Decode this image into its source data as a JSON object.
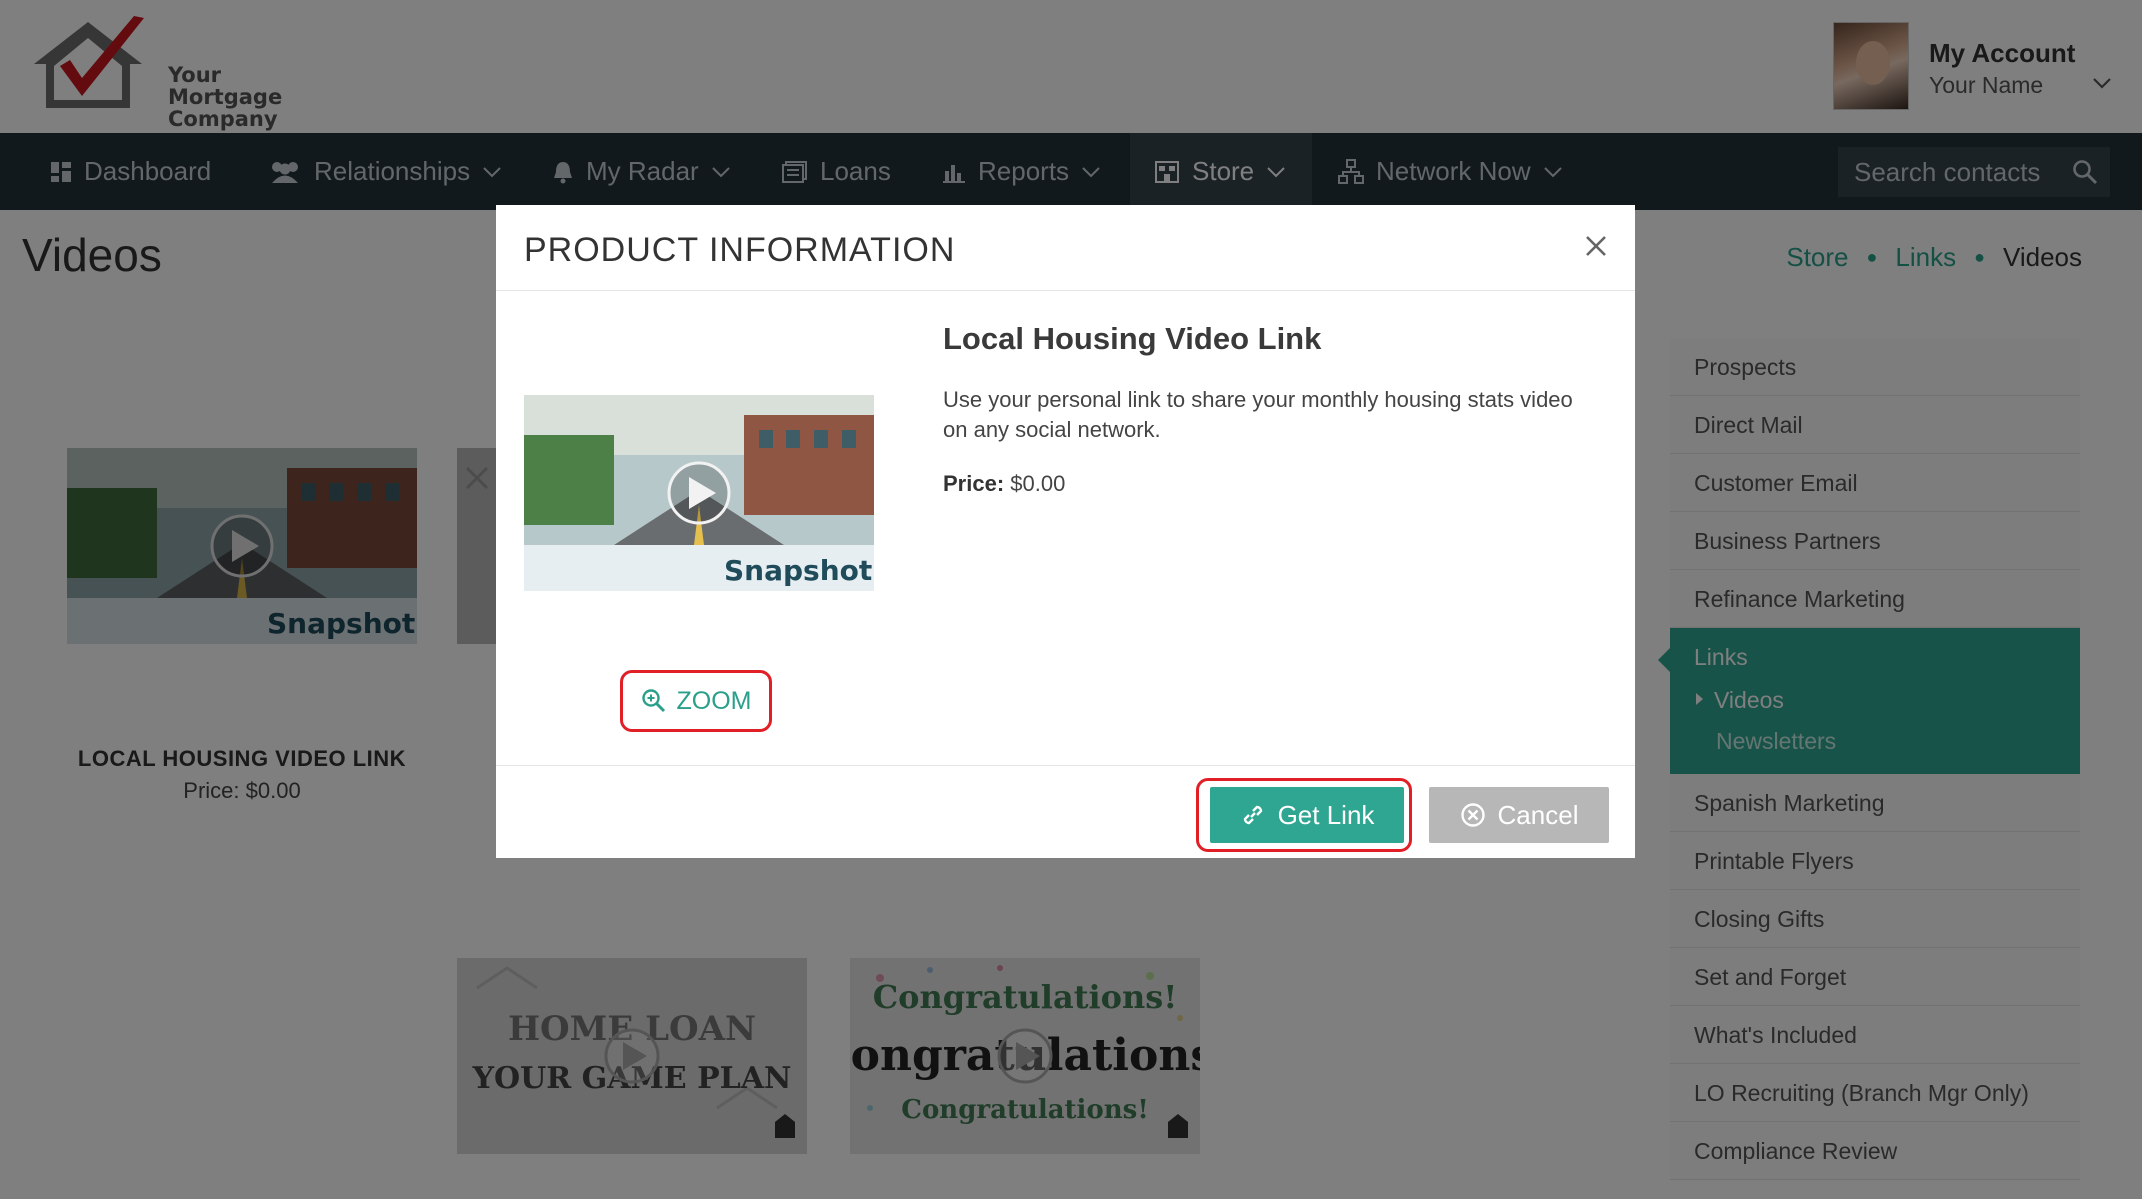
{
  "header": {
    "logo": {
      "line1": "Your",
      "line2": "Mortgage",
      "line3": "Company"
    },
    "account": {
      "title": "My Account",
      "name": "Your Name"
    }
  },
  "nav": {
    "items": [
      {
        "label": "Dashboard",
        "icon": "dashboard-icon"
      },
      {
        "label": "Relationships",
        "icon": "users-icon"
      },
      {
        "label": "My Radar",
        "icon": "bell-icon"
      },
      {
        "label": "Loans",
        "icon": "document-icon"
      },
      {
        "label": "Reports",
        "icon": "bar-chart-icon"
      },
      {
        "label": "Store",
        "icon": "store-icon"
      },
      {
        "label": "Network Now",
        "icon": "network-icon"
      }
    ],
    "search_placeholder": "Search contacts"
  },
  "page": {
    "title": "Videos",
    "breadcrumb": [
      "Store",
      "Links",
      "Videos"
    ]
  },
  "products": [
    {
      "name": "LOCAL HOUSING VIDEO LINK",
      "price": "Price: $0.00",
      "thumb_text": "Snapshot"
    },
    {
      "thumb_line1": "HOME LOAN",
      "thumb_line2": "YOUR GAME PLAN"
    },
    {
      "thumb_line1": "Congratulations!",
      "thumb_line2": "Congratulations!",
      "thumb_line3": "Congratulations!"
    }
  ],
  "sidebar": {
    "items_before": [
      "Prospects",
      "Direct Mail",
      "Customer Email",
      "Business Partners",
      "Refinance Marketing"
    ],
    "active": {
      "label": "Links",
      "sub_active": "Videos",
      "sub_other": "Newsletters"
    },
    "items_after": [
      "Spanish Marketing",
      "Printable Flyers",
      "Closing Gifts",
      "Set and Forget",
      "What's Included",
      "LO Recruiting (Branch Mgr Only)",
      "Compliance Review"
    ]
  },
  "modal": {
    "title": "PRODUCT INFORMATION",
    "product_title": "Local Housing Video Link",
    "description": "Use your personal link to share your monthly housing stats video on any social network.",
    "price_label": "Price:",
    "price_value": "$0.00",
    "thumb_text": "Snapshot",
    "zoom_label": "ZOOM",
    "get_link_label": "Get Link",
    "cancel_label": "Cancel"
  },
  "colors": {
    "accent": "#2ea692",
    "nav_bg": "#23323a",
    "highlight_ring": "#e01f26",
    "cancel_bg": "#b7b7b7"
  }
}
